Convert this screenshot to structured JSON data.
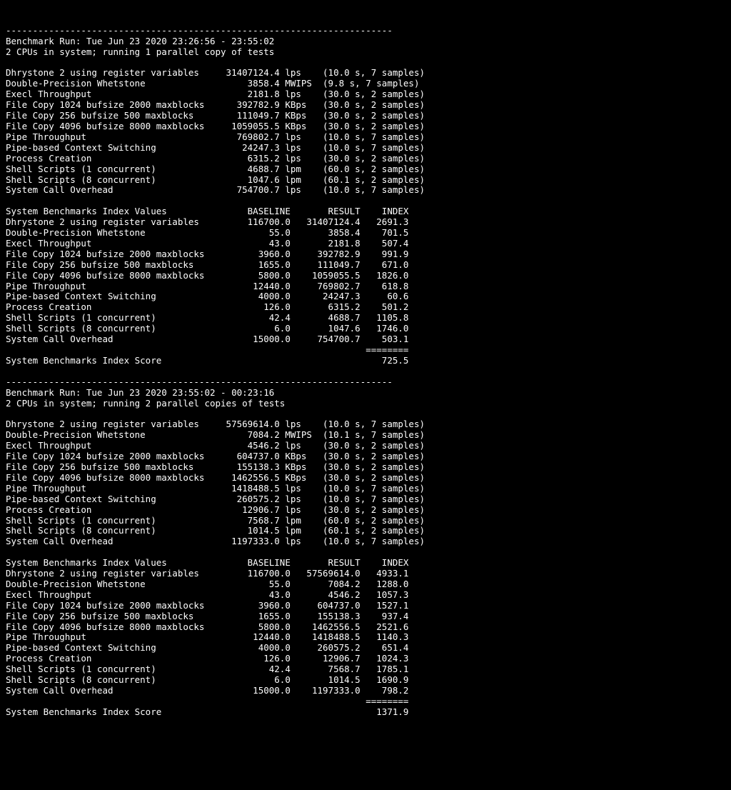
{
  "separator": "------------------------------------------------------------------------",
  "runs": [
    {
      "header": "Benchmark Run: Tue Jun 23 2020 23:26:56 - 23:55:02",
      "cpus_line": "2 CPUs in system; running 1 parallel copy of tests",
      "tests": [
        {
          "name": "Dhrystone 2 using register variables",
          "value": "31407124.4",
          "unit": "lps",
          "timing": "(10.0 s, 7 samples)"
        },
        {
          "name": "Double-Precision Whetstone",
          "value": "3858.4",
          "unit": "MWIPS",
          "timing": "(9.8 s, 7 samples)"
        },
        {
          "name": "Execl Throughput",
          "value": "2181.8",
          "unit": "lps",
          "timing": "(30.0 s, 2 samples)"
        },
        {
          "name": "File Copy 1024 bufsize 2000 maxblocks",
          "value": "392782.9",
          "unit": "KBps",
          "timing": "(30.0 s, 2 samples)"
        },
        {
          "name": "File Copy 256 bufsize 500 maxblocks",
          "value": "111049.7",
          "unit": "KBps",
          "timing": "(30.0 s, 2 samples)"
        },
        {
          "name": "File Copy 4096 bufsize 8000 maxblocks",
          "value": "1059055.5",
          "unit": "KBps",
          "timing": "(30.0 s, 2 samples)"
        },
        {
          "name": "Pipe Throughput",
          "value": "769802.7",
          "unit": "lps",
          "timing": "(10.0 s, 7 samples)"
        },
        {
          "name": "Pipe-based Context Switching",
          "value": "24247.3",
          "unit": "lps",
          "timing": "(10.0 s, 7 samples)"
        },
        {
          "name": "Process Creation",
          "value": "6315.2",
          "unit": "lps",
          "timing": "(30.0 s, 2 samples)"
        },
        {
          "name": "Shell Scripts (1 concurrent)",
          "value": "4688.7",
          "unit": "lpm",
          "timing": "(60.0 s, 2 samples)"
        },
        {
          "name": "Shell Scripts (8 concurrent)",
          "value": "1047.6",
          "unit": "lpm",
          "timing": "(60.1 s, 2 samples)"
        },
        {
          "name": "System Call Overhead",
          "value": "754700.7",
          "unit": "lps",
          "timing": "(10.0 s, 7 samples)"
        }
      ],
      "index_header": "System Benchmarks Index Values               BASELINE       RESULT    INDEX",
      "index": [
        {
          "name": "Dhrystone 2 using register variables",
          "baseline": "116700.0",
          "result": "31407124.4",
          "index": "2691.3"
        },
        {
          "name": "Double-Precision Whetstone",
          "baseline": "55.0",
          "result": "3858.4",
          "index": "701.5"
        },
        {
          "name": "Execl Throughput",
          "baseline": "43.0",
          "result": "2181.8",
          "index": "507.4"
        },
        {
          "name": "File Copy 1024 bufsize 2000 maxblocks",
          "baseline": "3960.0",
          "result": "392782.9",
          "index": "991.9"
        },
        {
          "name": "File Copy 256 bufsize 500 maxblocks",
          "baseline": "1655.0",
          "result": "111049.7",
          "index": "671.0"
        },
        {
          "name": "File Copy 4096 bufsize 8000 maxblocks",
          "baseline": "5800.0",
          "result": "1059055.5",
          "index": "1826.0"
        },
        {
          "name": "Pipe Throughput",
          "baseline": "12440.0",
          "result": "769802.7",
          "index": "618.8"
        },
        {
          "name": "Pipe-based Context Switching",
          "baseline": "4000.0",
          "result": "24247.3",
          "index": "60.6"
        },
        {
          "name": "Process Creation",
          "baseline": "126.0",
          "result": "6315.2",
          "index": "501.2"
        },
        {
          "name": "Shell Scripts (1 concurrent)",
          "baseline": "42.4",
          "result": "4688.7",
          "index": "1105.8"
        },
        {
          "name": "Shell Scripts (8 concurrent)",
          "baseline": "6.0",
          "result": "1047.6",
          "index": "1746.0"
        },
        {
          "name": "System Call Overhead",
          "baseline": "15000.0",
          "result": "754700.7",
          "index": "503.1"
        }
      ],
      "index_rule": "                                                                   ========",
      "index_score_label": "System Benchmarks Index Score",
      "index_score": "725.5"
    },
    {
      "header": "Benchmark Run: Tue Jun 23 2020 23:55:02 - 00:23:16",
      "cpus_line": "2 CPUs in system; running 2 parallel copies of tests",
      "tests": [
        {
          "name": "Dhrystone 2 using register variables",
          "value": "57569614.0",
          "unit": "lps",
          "timing": "(10.0 s, 7 samples)"
        },
        {
          "name": "Double-Precision Whetstone",
          "value": "7084.2",
          "unit": "MWIPS",
          "timing": "(10.1 s, 7 samples)"
        },
        {
          "name": "Execl Throughput",
          "value": "4546.2",
          "unit": "lps",
          "timing": "(30.0 s, 2 samples)"
        },
        {
          "name": "File Copy 1024 bufsize 2000 maxblocks",
          "value": "604737.0",
          "unit": "KBps",
          "timing": "(30.0 s, 2 samples)"
        },
        {
          "name": "File Copy 256 bufsize 500 maxblocks",
          "value": "155138.3",
          "unit": "KBps",
          "timing": "(30.0 s, 2 samples)"
        },
        {
          "name": "File Copy 4096 bufsize 8000 maxblocks",
          "value": "1462556.5",
          "unit": "KBps",
          "timing": "(30.0 s, 2 samples)"
        },
        {
          "name": "Pipe Throughput",
          "value": "1418488.5",
          "unit": "lps",
          "timing": "(10.0 s, 7 samples)"
        },
        {
          "name": "Pipe-based Context Switching",
          "value": "260575.2",
          "unit": "lps",
          "timing": "(10.0 s, 7 samples)"
        },
        {
          "name": "Process Creation",
          "value": "12906.7",
          "unit": "lps",
          "timing": "(30.0 s, 2 samples)"
        },
        {
          "name": "Shell Scripts (1 concurrent)",
          "value": "7568.7",
          "unit": "lpm",
          "timing": "(60.0 s, 2 samples)"
        },
        {
          "name": "Shell Scripts (8 concurrent)",
          "value": "1014.5",
          "unit": "lpm",
          "timing": "(60.1 s, 2 samples)"
        },
        {
          "name": "System Call Overhead",
          "value": "1197333.0",
          "unit": "lps",
          "timing": "(10.0 s, 7 samples)"
        }
      ],
      "index_header": "System Benchmarks Index Values               BASELINE       RESULT    INDEX",
      "index": [
        {
          "name": "Dhrystone 2 using register variables",
          "baseline": "116700.0",
          "result": "57569614.0",
          "index": "4933.1"
        },
        {
          "name": "Double-Precision Whetstone",
          "baseline": "55.0",
          "result": "7084.2",
          "index": "1288.0"
        },
        {
          "name": "Execl Throughput",
          "baseline": "43.0",
          "result": "4546.2",
          "index": "1057.3"
        },
        {
          "name": "File Copy 1024 bufsize 2000 maxblocks",
          "baseline": "3960.0",
          "result": "604737.0",
          "index": "1527.1"
        },
        {
          "name": "File Copy 256 bufsize 500 maxblocks",
          "baseline": "1655.0",
          "result": "155138.3",
          "index": "937.4"
        },
        {
          "name": "File Copy 4096 bufsize 8000 maxblocks",
          "baseline": "5800.0",
          "result": "1462556.5",
          "index": "2521.6"
        },
        {
          "name": "Pipe Throughput",
          "baseline": "12440.0",
          "result": "1418488.5",
          "index": "1140.3"
        },
        {
          "name": "Pipe-based Context Switching",
          "baseline": "4000.0",
          "result": "260575.2",
          "index": "651.4"
        },
        {
          "name": "Process Creation",
          "baseline": "126.0",
          "result": "12906.7",
          "index": "1024.3"
        },
        {
          "name": "Shell Scripts (1 concurrent)",
          "baseline": "42.4",
          "result": "7568.7",
          "index": "1785.1"
        },
        {
          "name": "Shell Scripts (8 concurrent)",
          "baseline": "6.0",
          "result": "1014.5",
          "index": "1690.9"
        },
        {
          "name": "System Call Overhead",
          "baseline": "15000.0",
          "result": "1197333.0",
          "index": "798.2"
        }
      ],
      "index_rule": "                                                                   ========",
      "index_score_label": "System Benchmarks Index Score",
      "index_score": "1371.9"
    }
  ]
}
